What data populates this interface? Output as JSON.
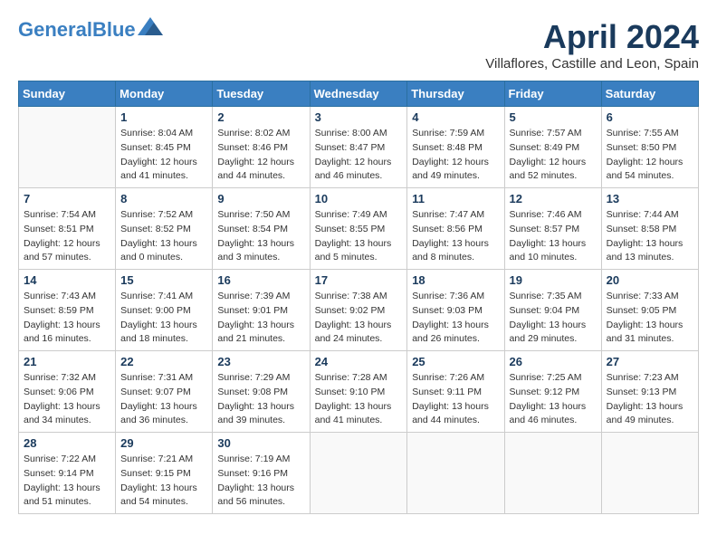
{
  "header": {
    "logo_general": "General",
    "logo_blue": "Blue",
    "month_title": "April 2024",
    "location": "Villaflores, Castille and Leon, Spain"
  },
  "days_of_week": [
    "Sunday",
    "Monday",
    "Tuesday",
    "Wednesday",
    "Thursday",
    "Friday",
    "Saturday"
  ],
  "weeks": [
    [
      {
        "day": "",
        "content": ""
      },
      {
        "day": "1",
        "content": "Sunrise: 8:04 AM\nSunset: 8:45 PM\nDaylight: 12 hours\nand 41 minutes."
      },
      {
        "day": "2",
        "content": "Sunrise: 8:02 AM\nSunset: 8:46 PM\nDaylight: 12 hours\nand 44 minutes."
      },
      {
        "day": "3",
        "content": "Sunrise: 8:00 AM\nSunset: 8:47 PM\nDaylight: 12 hours\nand 46 minutes."
      },
      {
        "day": "4",
        "content": "Sunrise: 7:59 AM\nSunset: 8:48 PM\nDaylight: 12 hours\nand 49 minutes."
      },
      {
        "day": "5",
        "content": "Sunrise: 7:57 AM\nSunset: 8:49 PM\nDaylight: 12 hours\nand 52 minutes."
      },
      {
        "day": "6",
        "content": "Sunrise: 7:55 AM\nSunset: 8:50 PM\nDaylight: 12 hours\nand 54 minutes."
      }
    ],
    [
      {
        "day": "7",
        "content": "Sunrise: 7:54 AM\nSunset: 8:51 PM\nDaylight: 12 hours\nand 57 minutes."
      },
      {
        "day": "8",
        "content": "Sunrise: 7:52 AM\nSunset: 8:52 PM\nDaylight: 13 hours\nand 0 minutes."
      },
      {
        "day": "9",
        "content": "Sunrise: 7:50 AM\nSunset: 8:54 PM\nDaylight: 13 hours\nand 3 minutes."
      },
      {
        "day": "10",
        "content": "Sunrise: 7:49 AM\nSunset: 8:55 PM\nDaylight: 13 hours\nand 5 minutes."
      },
      {
        "day": "11",
        "content": "Sunrise: 7:47 AM\nSunset: 8:56 PM\nDaylight: 13 hours\nand 8 minutes."
      },
      {
        "day": "12",
        "content": "Sunrise: 7:46 AM\nSunset: 8:57 PM\nDaylight: 13 hours\nand 10 minutes."
      },
      {
        "day": "13",
        "content": "Sunrise: 7:44 AM\nSunset: 8:58 PM\nDaylight: 13 hours\nand 13 minutes."
      }
    ],
    [
      {
        "day": "14",
        "content": "Sunrise: 7:43 AM\nSunset: 8:59 PM\nDaylight: 13 hours\nand 16 minutes."
      },
      {
        "day": "15",
        "content": "Sunrise: 7:41 AM\nSunset: 9:00 PM\nDaylight: 13 hours\nand 18 minutes."
      },
      {
        "day": "16",
        "content": "Sunrise: 7:39 AM\nSunset: 9:01 PM\nDaylight: 13 hours\nand 21 minutes."
      },
      {
        "day": "17",
        "content": "Sunrise: 7:38 AM\nSunset: 9:02 PM\nDaylight: 13 hours\nand 24 minutes."
      },
      {
        "day": "18",
        "content": "Sunrise: 7:36 AM\nSunset: 9:03 PM\nDaylight: 13 hours\nand 26 minutes."
      },
      {
        "day": "19",
        "content": "Sunrise: 7:35 AM\nSunset: 9:04 PM\nDaylight: 13 hours\nand 29 minutes."
      },
      {
        "day": "20",
        "content": "Sunrise: 7:33 AM\nSunset: 9:05 PM\nDaylight: 13 hours\nand 31 minutes."
      }
    ],
    [
      {
        "day": "21",
        "content": "Sunrise: 7:32 AM\nSunset: 9:06 PM\nDaylight: 13 hours\nand 34 minutes."
      },
      {
        "day": "22",
        "content": "Sunrise: 7:31 AM\nSunset: 9:07 PM\nDaylight: 13 hours\nand 36 minutes."
      },
      {
        "day": "23",
        "content": "Sunrise: 7:29 AM\nSunset: 9:08 PM\nDaylight: 13 hours\nand 39 minutes."
      },
      {
        "day": "24",
        "content": "Sunrise: 7:28 AM\nSunset: 9:10 PM\nDaylight: 13 hours\nand 41 minutes."
      },
      {
        "day": "25",
        "content": "Sunrise: 7:26 AM\nSunset: 9:11 PM\nDaylight: 13 hours\nand 44 minutes."
      },
      {
        "day": "26",
        "content": "Sunrise: 7:25 AM\nSunset: 9:12 PM\nDaylight: 13 hours\nand 46 minutes."
      },
      {
        "day": "27",
        "content": "Sunrise: 7:23 AM\nSunset: 9:13 PM\nDaylight: 13 hours\nand 49 minutes."
      }
    ],
    [
      {
        "day": "28",
        "content": "Sunrise: 7:22 AM\nSunset: 9:14 PM\nDaylight: 13 hours\nand 51 minutes."
      },
      {
        "day": "29",
        "content": "Sunrise: 7:21 AM\nSunset: 9:15 PM\nDaylight: 13 hours\nand 54 minutes."
      },
      {
        "day": "30",
        "content": "Sunrise: 7:19 AM\nSunset: 9:16 PM\nDaylight: 13 hours\nand 56 minutes."
      },
      {
        "day": "",
        "content": ""
      },
      {
        "day": "",
        "content": ""
      },
      {
        "day": "",
        "content": ""
      },
      {
        "day": "",
        "content": ""
      }
    ]
  ]
}
